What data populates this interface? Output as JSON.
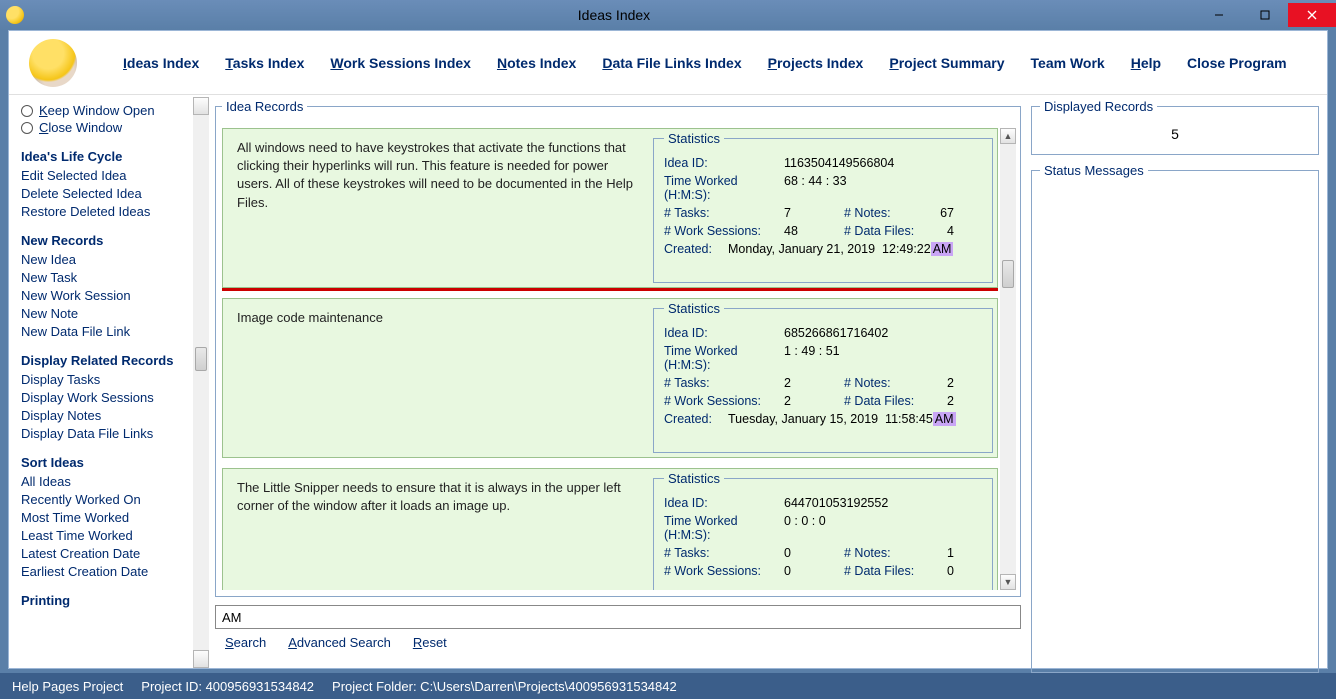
{
  "window": {
    "title": "Ideas Index"
  },
  "menu": {
    "ideas_index": "deas Index",
    "tasks_index": "asks Index",
    "work_sessions_index": "ork Sessions Index",
    "notes_index": "otes Index",
    "data_file_links_index": "ata File Links Index",
    "projects_index": "rojects Index",
    "project_summary": "roject Summary",
    "team_work": "Team Work",
    "help": "elp",
    "close_program": "Close Program",
    "u_ideas": "I",
    "u_tasks": "T",
    "u_work": "W",
    "u_notes": "N",
    "u_data": "D",
    "u_projects": "P",
    "u_summary": "P",
    "u_help": "H"
  },
  "sidebar": {
    "keep_open": "eep Window Open",
    "close_win": "lose Window",
    "u_keep": "K",
    "u_close": "C",
    "heading_lifecycle": "Idea's Life Cycle",
    "edit_selected": "Edit Selected Idea",
    "delete_selected": "Delete Selected Idea",
    "restore_deleted": "Restore Deleted Ideas",
    "heading_new": "New Records",
    "new_idea": "New Idea",
    "new_task": "New Task",
    "new_work_session": "New Work Session",
    "new_note": "New Note",
    "new_data_file_link": "New Data File Link",
    "heading_display": "Display Related Records",
    "disp_tasks": "Display Tasks",
    "disp_work": "Display Work Sessions",
    "disp_notes": "Display Notes",
    "disp_data": "Display Data File Links",
    "heading_sort": "Sort Ideas",
    "all_ideas": "All Ideas",
    "recently": "Recently Worked On",
    "most_time": "Most Time Worked",
    "least_time": "Least Time Worked",
    "latest_date": "Latest Creation Date",
    "earliest_date": "Earliest Creation Date",
    "heading_printing": "Printing"
  },
  "group": {
    "idea_records": "Idea Records",
    "statistics": "Statistics",
    "displayed_records": "Displayed Records",
    "status_messages": "Status Messages"
  },
  "labels": {
    "idea_id": "Idea ID:",
    "time_worked": "Time Worked (H:M:S):",
    "tasks": "# Tasks:",
    "notes": "# Notes:",
    "work_sessions": "# Work Sessions:",
    "data_files": "# Data Files:",
    "created": "Created:"
  },
  "ideas": [
    {
      "desc": "All windows need to have keystrokes that activate the functions that clicking their hyperlinks will run. This feature is needed for power users.\nAll of these keystrokes will need to be documented in the Help Files.",
      "id": "1163504149566804",
      "time": "68  :  44  :  33",
      "tasks": "7",
      "notes": "67",
      "work_sessions": "48",
      "data_files": "4",
      "created_date": "Monday, January 21, 2019",
      "created_time": "12:49:22",
      "created_ampm": "AM",
      "selected": true
    },
    {
      "desc": "Image code maintenance",
      "id": "685266861716402",
      "time": "1  :  49  :  51",
      "tasks": "2",
      "notes": "2",
      "work_sessions": "2",
      "data_files": "2",
      "created_date": "Tuesday, January 15, 2019",
      "created_time": "11:58:45",
      "created_ampm": "AM",
      "selected": false
    },
    {
      "desc": "The Little Snipper needs to ensure that it is always in the upper left corner of the window after it loads an image up.",
      "id": "644701053192552",
      "time": "0  :  0  :  0",
      "tasks": "0",
      "notes": "1",
      "work_sessions": "0",
      "data_files": "0",
      "created_date": "",
      "created_time": "",
      "created_ampm": "",
      "selected": false
    }
  ],
  "search": {
    "value": "AM",
    "search": "earch",
    "u_search": "S",
    "advanced": "dvanced Search",
    "u_adv": "A",
    "reset": "eset",
    "u_reset": "R"
  },
  "displayed_records_value": "5",
  "statusbar": {
    "help_project": "Help Pages Project",
    "project_id": "Project ID: 400956931534842",
    "project_folder": "Project Folder: C:\\Users\\Darren\\Projects\\400956931534842"
  }
}
